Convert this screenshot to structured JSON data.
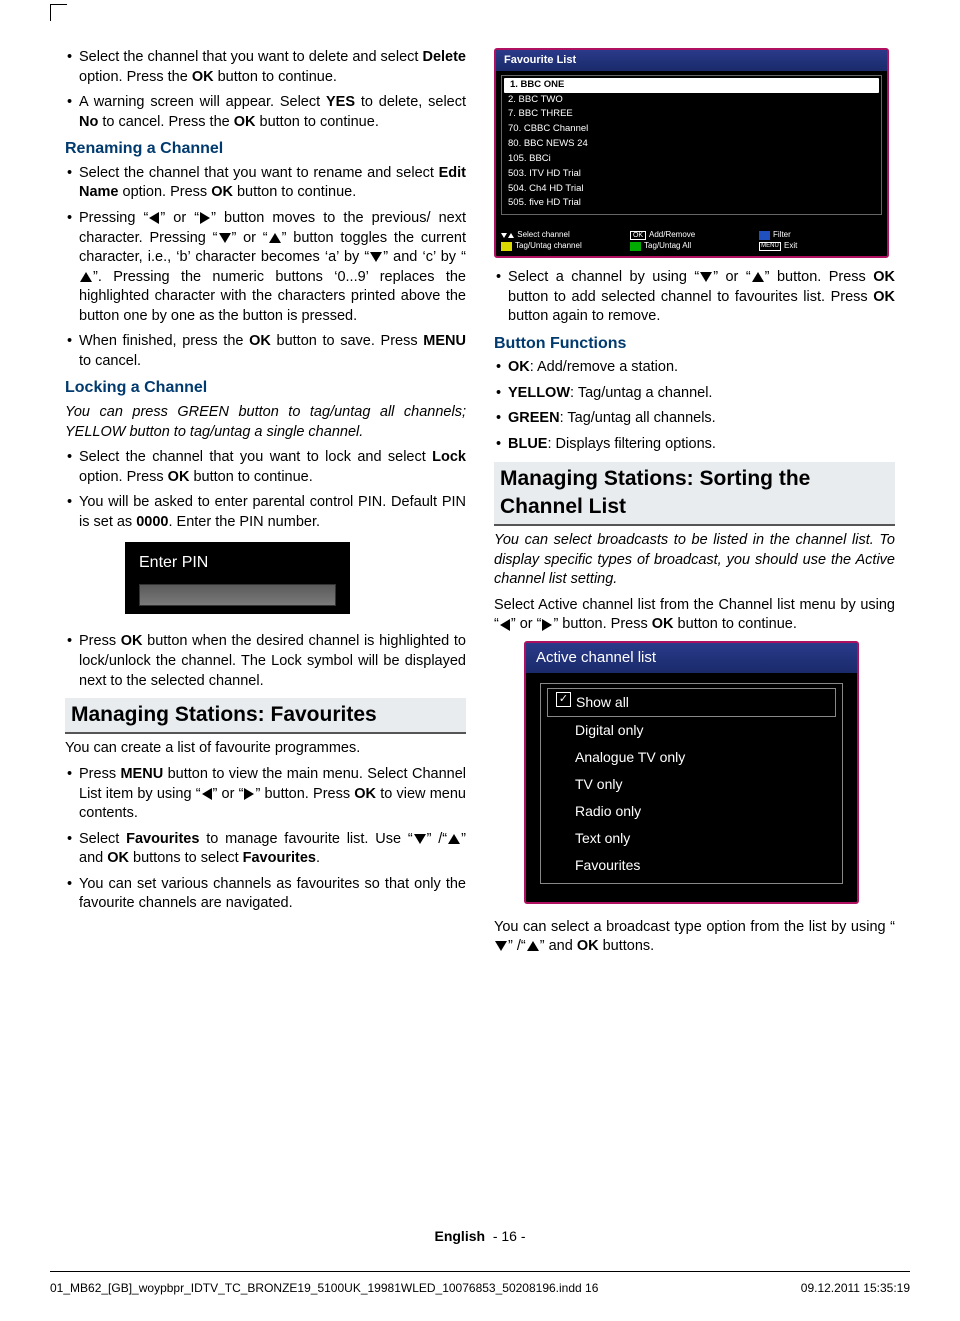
{
  "left": {
    "p1": "Select the channel that you want to delete and select ",
    "p1b": "Delete",
    "p1c": " option. Press the ",
    "p1d": "OK",
    "p1e": " button to continue.",
    "p2a": "A warning screen will appear. Select ",
    "p2b": "YES",
    "p2c": " to delete, select ",
    "p2d": "No",
    "p2e": " to cancel. Press the ",
    "p2f": "OK",
    "p2g": " button to continue.",
    "h_rename": "Renaming a Channel",
    "p3a": "Select the channel that you want to rename and select ",
    "p3b": "Edit Name",
    "p3c": " option. Press ",
    "p3d": "OK",
    "p3e": " button to continue.",
    "p4a": "Pressing “",
    "p4b": "” or “",
    "p4c": "” button moves to the previous/ next character. Pressing “",
    "p4d": "” or “",
    "p4e": "” button toggles the current character, i.e., ‘b’ character becomes ‘a’ by “",
    "p4f": "” and ‘c’ by “",
    "p4g": "”. Pressing the numeric buttons ‘0...9’ replaces the highlighted character with the characters printed above the button one by one as the button is pressed.",
    "p5a": "When finished, press the ",
    "p5b": "OK",
    "p5c": " button to save. Press ",
    "p5d": "MENU",
    "p5e": " to cancel.",
    "h_lock": "Locking a Channel",
    "p6": "You can press GREEN button to tag/untag all channels; YELLOW button to tag/untag a single channel.",
    "p7a": "Select the channel that you want to lock and select ",
    "p7b": "Lock",
    "p7c": " option. Press ",
    "p7d": "OK",
    "p7e": " button to continue.",
    "p8a": "You will be asked to enter parental control PIN. Default PIN is set as ",
    "p8b": "0000",
    "p8c": ". Enter the PIN number.",
    "pin_label": "Enter PIN",
    "p9a": "Press ",
    "p9b": "OK",
    "p9c": " button when the desired channel is highlighted to lock/unlock the channel. The Lock symbol will be displayed next to the selected channel.",
    "h_fav": "Managing Stations: Favourites",
    "p10": "You can create a list of favourite programmes.",
    "p11a": "Press ",
    "p11b": "MENU",
    "p11c": " button to view the main menu. Select Channel List item by using “",
    "p11d": "” or “",
    "p11e": "” button. Press ",
    "p11f": "OK",
    "p11g": " to view menu contents.",
    "p12a": "Select ",
    "p12b": "Favourites",
    "p12c": " to manage favourite list. Use “",
    "p12d": "” /“",
    "p12e": "” and ",
    "p12f": "OK",
    "p12g": " buttons to select ",
    "p12h": "Favourites",
    "p12i": ".",
    "p13": "You can set various channels as favourites so that only the favourite channels are navigated."
  },
  "osd_fav": {
    "title": "Favourite List",
    "rows": [
      "1. BBC ONE",
      "2. BBC TWO",
      "7. BBC THREE",
      "70. CBBC Channel",
      "80. BBC NEWS 24",
      "105. BBCi",
      "503. ITV HD Trial",
      "504. Ch4 HD Trial",
      "505. five HD Trial"
    ],
    "f1a": "Select channel",
    "f1b": "Tag/Untag channel",
    "f2a": "Add/Remove",
    "f2b": "Tag/Untag All",
    "f3a": "Filter",
    "f3b": "Exit"
  },
  "right": {
    "p1a": "Select a channel by using “",
    "p1b": "” or “",
    "p1c": "” button. Press ",
    "p1d": "OK",
    "p1e": " button to add selected channel to favourites list. Press ",
    "p1f": "OK",
    "p1g": " button again to remove.",
    "h_btn": "Button Functions",
    "b1a": "OK",
    "b1b": ": Add/remove a station.",
    "b2a": "YELLOW",
    "b2b": ": Tag/untag a channel.",
    "b3a": "GREEN",
    "b3b": ": Tag/untag all channels.",
    "b4a": "BLUE",
    "b4b": ": Displays filtering options.",
    "h_sort": "Managing Stations: Sorting the Channel List",
    "p2": "You can select broadcasts to be listed in the channel list. To display specific types of broadcast, you should use the Active channel list setting.",
    "p3a": "Select Active channel list from the Channel list menu by using “",
    "p3b": "” or “",
    "p3c": "” button. Press ",
    "p3d": "OK",
    "p3e": " button to continue.",
    "p4a": "You can select a broadcast type option from the list by using “",
    "p4b": "” /“",
    "p4c": "” and ",
    "p4d": "OK",
    "p4e": " buttons."
  },
  "osd_acl": {
    "title": "Active channel list",
    "opts": [
      "Show all",
      "Digital only",
      "Analogue TV only",
      "TV only",
      "Radio only",
      "Text only",
      "Favourites"
    ]
  },
  "footer": {
    "lang": "English",
    "page": "- 16 -",
    "file": "01_MB62_[GB]_woypbpr_IDTV_TC_BRONZE19_5100UK_19981WLED_10076853_50208196.indd   16",
    "ts": "09.12.2011   15:35:19"
  }
}
